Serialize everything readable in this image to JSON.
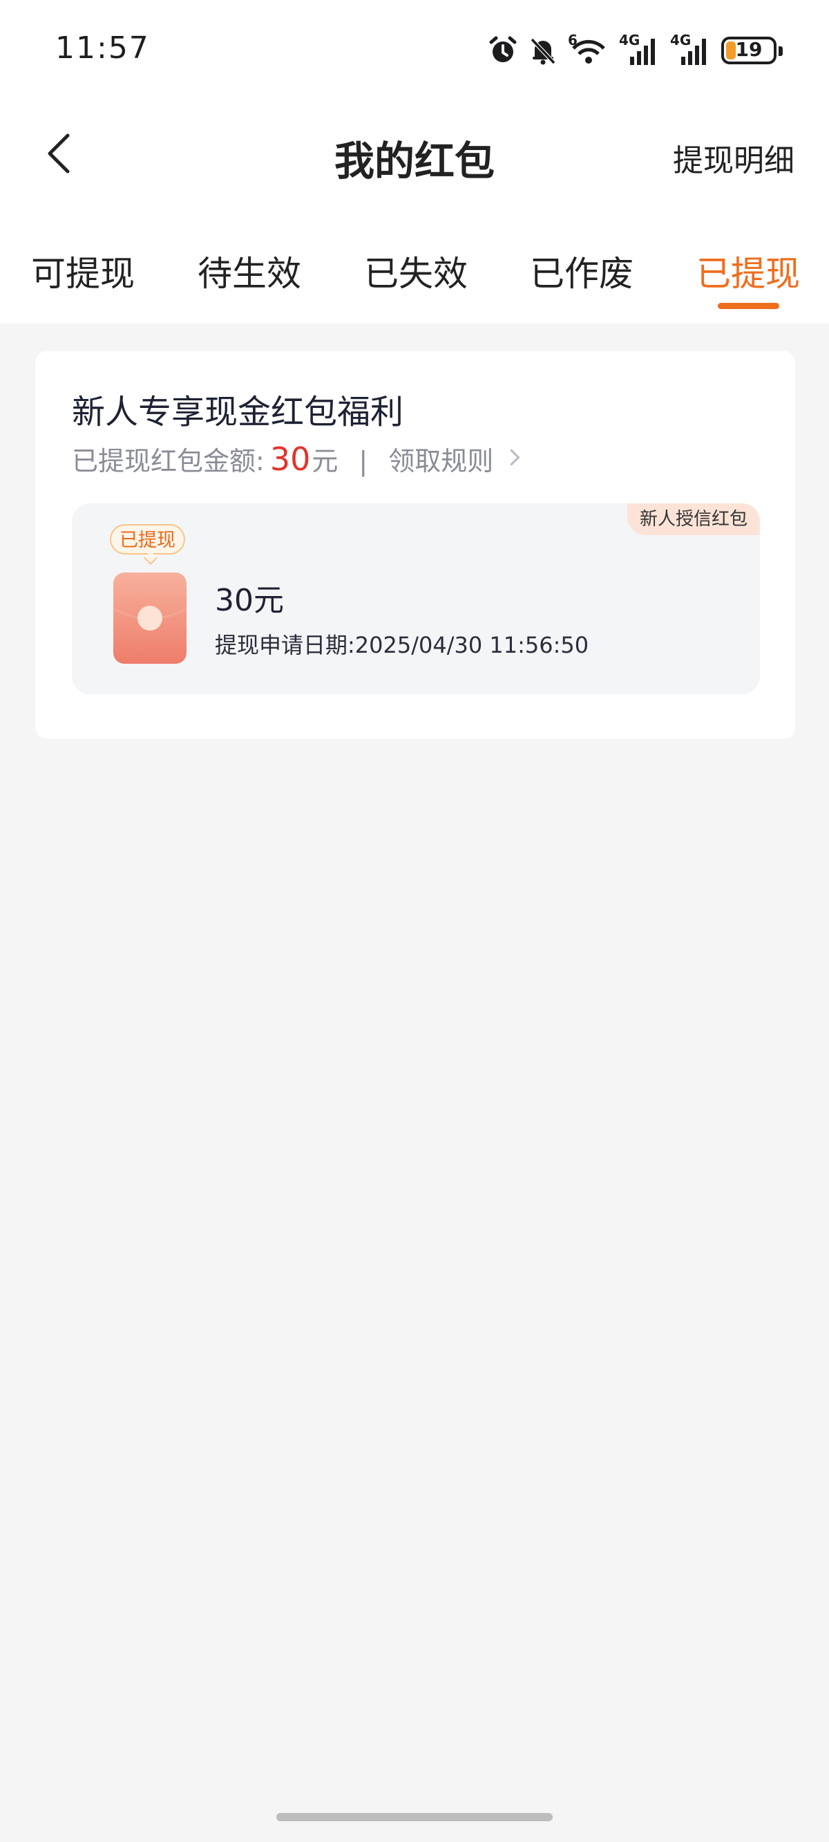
{
  "status_bar": {
    "time": "11:57",
    "network1": "4G",
    "network2": "4G",
    "wifi_label": "6",
    "battery": "19",
    "icons": [
      "alarm-icon",
      "mute-icon",
      "wifi-icon",
      "signal-icon",
      "signal-icon",
      "battery-icon"
    ]
  },
  "nav": {
    "title": "我的红包",
    "detail_link": "提现明细",
    "back_icon": "chevron-left-icon"
  },
  "tabs": [
    {
      "label": "可提现",
      "active": false
    },
    {
      "label": "待生效",
      "active": false
    },
    {
      "label": "已失效",
      "active": false
    },
    {
      "label": "已作废",
      "active": false
    },
    {
      "label": "已提现",
      "active": true
    }
  ],
  "card": {
    "title": "新人专享现金红包福利",
    "summary_label": "已提现红包金额:",
    "summary_amount": "30",
    "summary_unit": "元",
    "separator": "|",
    "rules_link": "领取规则"
  },
  "item": {
    "tag": "新人授信红包",
    "badge": "已提现",
    "amount": "30元",
    "date": "提现申请日期:2025/04/30 11:56:50"
  },
  "colors": {
    "accent": "#ee6e1e",
    "amount": "#e0352b",
    "background": "#f5f5f5"
  }
}
